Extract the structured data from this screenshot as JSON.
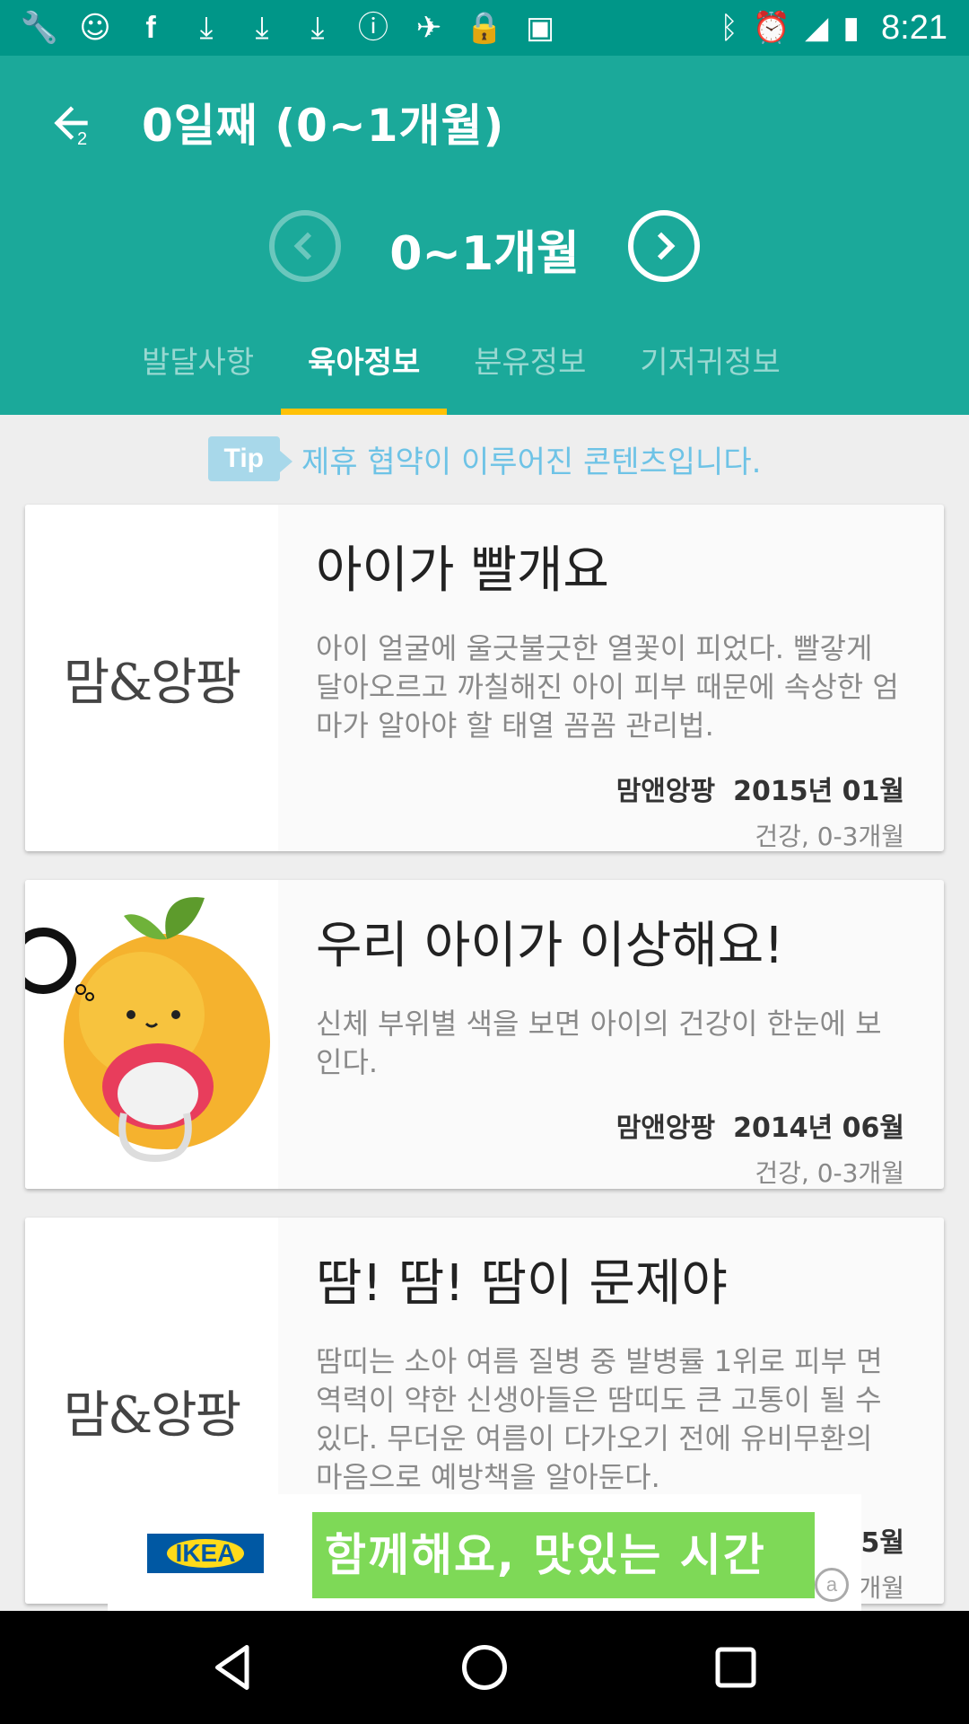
{
  "status_bar": {
    "time": "8:21",
    "icons": [
      "wrench-icon",
      "face-icon",
      "facebook-icon",
      "download-icon",
      "download-icon",
      "download-icon",
      "info-icon",
      "fake-gps-icon",
      "lock-icon",
      "android-icon",
      "bluetooth-icon",
      "alarm-icon",
      "signal-icon",
      "battery-icon"
    ]
  },
  "header": {
    "back_badge": "2",
    "title": "0일째 (0~1개월)",
    "month_label": "0~1개월",
    "tabs": [
      {
        "label": "발달사항",
        "active": false
      },
      {
        "label": "육아정보",
        "active": true
      },
      {
        "label": "분유정보",
        "active": false
      },
      {
        "label": "기저귀정보",
        "active": false
      }
    ],
    "accent": "#1ba99a",
    "tab_indicator": "#ffc107"
  },
  "tip": {
    "badge": "Tip",
    "text": "제휴 협약이 이루어진 콘텐츠입니다."
  },
  "cards": [
    {
      "image_text": "맘&앙팡",
      "title": "아이가 빨개요",
      "description": "아이 얼굴에 울긋불긋한 열꽃이 피었다. 빨갛게 달아오르고 까칠해진 아이 피부 때문에 속상한 엄마가 알아야 할 태열 꼼꼼 관리법.",
      "source": "맘앤앙팡",
      "date": "2015년 01월",
      "tags": "건강, 0-3개월"
    },
    {
      "image_text": "",
      "title": "우리 아이가 이상해요!",
      "description": "신체 부위별 색을 보면 아이의 건강이 한눈에 보인다.",
      "source": "맘앤앙팡",
      "date": "2014년 06월",
      "tags": "건강, 0-3개월"
    },
    {
      "image_text": "맘&앙팡",
      "title": "땀! 땀! 땀이 문제야",
      "description": "땀띠는 소아 여름 질병 중 발병률 1위로 피부 면역력이 약한 신생아들은 땀띠도 큰 고통이 될 수 있다. 무더운 여름이 다가오기 전에 유비무환의 마음으로 예방책을 알아둔다.",
      "source": "",
      "date": "5월",
      "tags": "개월"
    }
  ],
  "ad": {
    "brand": "IKEA",
    "text": "함께해요, 맛있는 시간",
    "badge": "a"
  }
}
